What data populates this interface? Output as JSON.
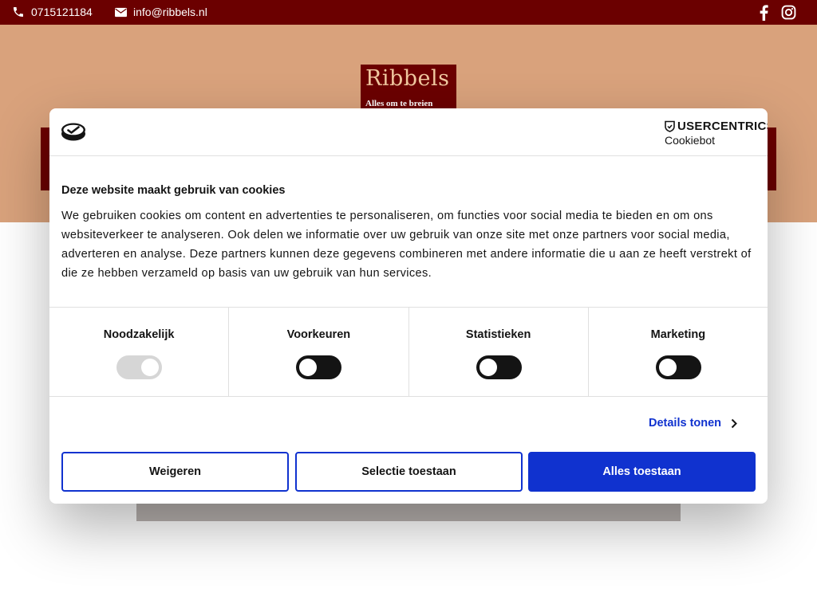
{
  "topbar": {
    "phone": "0715121184",
    "email": "info@ribbels.nl",
    "background": "#6b0000"
  },
  "social": {
    "facebook": "facebook-icon",
    "instagram": "instagram-icon"
  },
  "logo": {
    "name": "Ribbels",
    "tagline": "Alles om te breien"
  },
  "header": {
    "background": "#d9a27c"
  },
  "dialog": {
    "provider_name": "USERCENTRICS",
    "provider_product": "Cookiebot",
    "title": "Deze website maakt gebruik van cookies",
    "body": "We gebruiken cookies om content en advertenties te personaliseren, om functies voor social media te bieden en om ons websiteverkeer te analyseren. Ook delen we informatie over uw gebruik van onze site met onze partners voor social media, adverteren en analyse. Deze partners kunnen deze gegevens combineren met andere informatie die u aan ze heeft verstrekt of die ze hebben verzameld op basis van uw gebruik van hun services.",
    "categories": [
      {
        "label": "Noodzakelijk",
        "checked": true,
        "disabled": true
      },
      {
        "label": "Voorkeuren",
        "checked": false,
        "disabled": false
      },
      {
        "label": "Statistieken",
        "checked": false,
        "disabled": false
      },
      {
        "label": "Marketing",
        "checked": false,
        "disabled": false
      }
    ],
    "details_label": "Details tonen",
    "buttons": {
      "deny": "Weigeren",
      "selection": "Selectie toestaan",
      "allow_all": "Alles toestaan"
    },
    "accent": "#1032cf"
  }
}
